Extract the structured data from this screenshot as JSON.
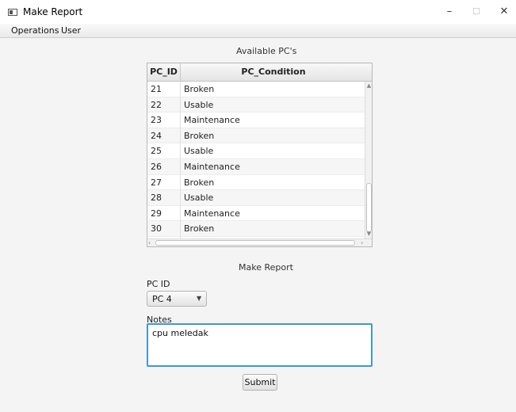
{
  "window": {
    "title": "Make Report",
    "controls": {
      "minimize": "–",
      "maximize": "☐",
      "close": "✕"
    }
  },
  "menu": {
    "items": [
      "Operations",
      "User"
    ]
  },
  "table": {
    "label": "Available PC's",
    "headers": [
      "PC_ID",
      "PC_Condition"
    ],
    "rows": [
      [
        "21",
        "Broken"
      ],
      [
        "22",
        "Usable"
      ],
      [
        "23",
        "Maintenance"
      ],
      [
        "24",
        "Broken"
      ],
      [
        "25",
        "Usable"
      ],
      [
        "26",
        "Maintenance"
      ],
      [
        "27",
        "Broken"
      ],
      [
        "28",
        "Usable"
      ],
      [
        "29",
        "Maintenance"
      ],
      [
        "30",
        "Broken"
      ]
    ]
  },
  "form": {
    "title": "Make Report",
    "pc_id_label": "PC ID",
    "pc_id_value": "PC 4",
    "notes_label": "Notes",
    "notes_value": "cpu meledak",
    "submit_label": "Submit"
  },
  "colors": {
    "focus_accent": "#3b99d6"
  }
}
